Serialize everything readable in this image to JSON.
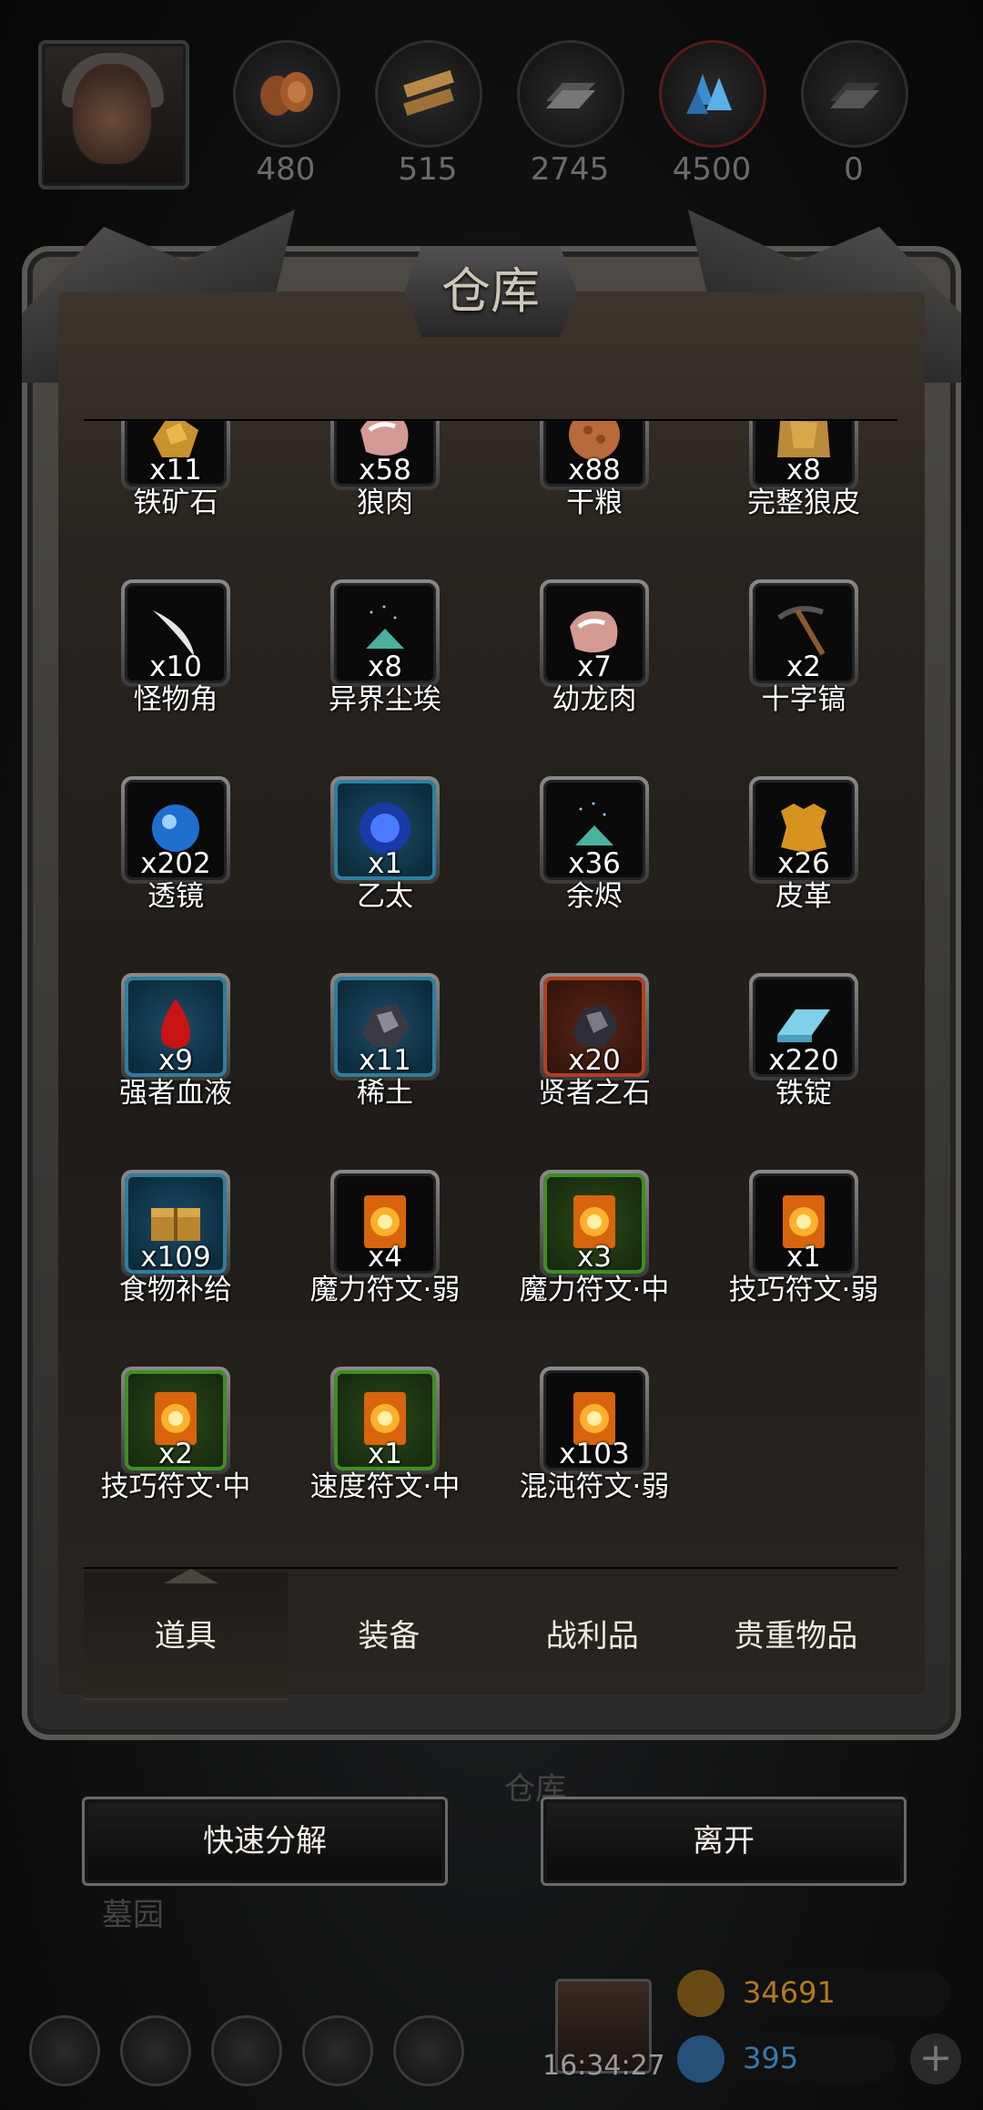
{
  "hud": {
    "resources": [
      {
        "name": "wood-log-icon",
        "value": "480"
      },
      {
        "name": "plank-icon",
        "value": "515"
      },
      {
        "name": "iron-ingot-icon",
        "value": "2745"
      },
      {
        "name": "crystal-icon",
        "value": "4500"
      },
      {
        "name": "dark-ingot-icon",
        "value": "0"
      }
    ]
  },
  "panel": {
    "title": "仓库"
  },
  "items": [
    {
      "qty": "x11",
      "name": "铁矿石",
      "icon": "iron-ore-icon",
      "frame": "grey"
    },
    {
      "qty": "x58",
      "name": "狼肉",
      "icon": "meat-icon",
      "frame": "grey"
    },
    {
      "qty": "x88",
      "name": "干粮",
      "icon": "ration-icon",
      "frame": "grey"
    },
    {
      "qty": "x8",
      "name": "完整狼皮",
      "icon": "pelt-icon",
      "frame": "grey"
    },
    {
      "qty": "x10",
      "name": "怪物角",
      "icon": "horn-icon",
      "frame": "grey"
    },
    {
      "qty": "x8",
      "name": "异界尘埃",
      "icon": "dust-icon",
      "frame": "grey"
    },
    {
      "qty": "x7",
      "name": "幼龙肉",
      "icon": "meat-icon",
      "frame": "grey"
    },
    {
      "qty": "x2",
      "name": "十字镐",
      "icon": "pickaxe-icon",
      "frame": "grey"
    },
    {
      "qty": "x202",
      "name": "透镜",
      "icon": "lens-icon",
      "frame": "grey"
    },
    {
      "qty": "x1",
      "name": "乙太",
      "icon": "ether-orb-icon",
      "frame": "blue"
    },
    {
      "qty": "x36",
      "name": "余烬",
      "icon": "dust-icon",
      "frame": "grey"
    },
    {
      "qty": "x26",
      "name": "皮革",
      "icon": "leather-icon",
      "frame": "grey"
    },
    {
      "qty": "x9",
      "name": "强者血液",
      "icon": "blood-drop-icon",
      "frame": "blue"
    },
    {
      "qty": "x11",
      "name": "稀土",
      "icon": "rare-earth-icon",
      "frame": "blue"
    },
    {
      "qty": "x20",
      "name": "贤者之石",
      "icon": "sage-stone-icon",
      "frame": "red"
    },
    {
      "qty": "x220",
      "name": "铁锭",
      "icon": "ingot-icon",
      "frame": "grey"
    },
    {
      "qty": "x109",
      "name": "食物补给",
      "icon": "supply-crate-icon",
      "frame": "blue"
    },
    {
      "qty": "x4",
      "name": "魔力符文·弱",
      "icon": "rune-icon",
      "frame": "grey"
    },
    {
      "qty": "x3",
      "name": "魔力符文·中",
      "icon": "rune-icon",
      "frame": "green"
    },
    {
      "qty": "x1",
      "name": "技巧符文·弱",
      "icon": "rune-icon",
      "frame": "grey"
    },
    {
      "qty": "x2",
      "name": "技巧符文·中",
      "icon": "rune-icon",
      "frame": "green"
    },
    {
      "qty": "x1",
      "name": "速度符文·中",
      "icon": "rune-icon",
      "frame": "green"
    },
    {
      "qty": "x103",
      "name": "混沌符文·弱",
      "icon": "rune-icon",
      "frame": "grey"
    }
  ],
  "tabs": [
    {
      "label": "道具",
      "active": true
    },
    {
      "label": "装备",
      "active": false
    },
    {
      "label": "战利品",
      "active": false
    },
    {
      "label": "贵重物品",
      "active": false
    }
  ],
  "buttons": {
    "decompose": "快速分解",
    "leave": "离开"
  },
  "background_labels": {
    "warehouse": "仓库",
    "graveyard": "墓园"
  },
  "footer": {
    "time": "16:34:27",
    "gold": "34691",
    "gems": "395"
  },
  "colors": {
    "gold": "#b07a22",
    "gem": "#3a78b0",
    "blue_frame": "#2f7ea0",
    "green_frame": "#3f8e22",
    "red_frame": "#b2401e"
  }
}
